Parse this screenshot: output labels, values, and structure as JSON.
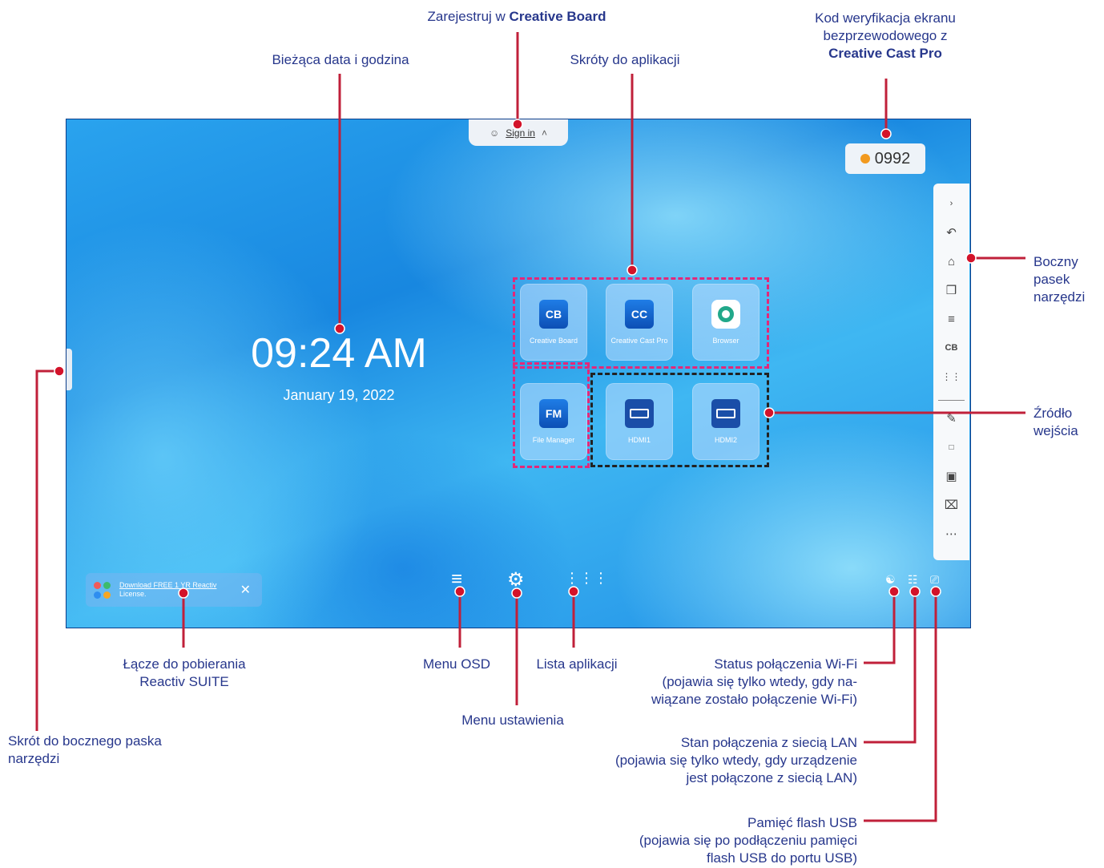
{
  "annotations": {
    "register": {
      "text": "Zarejestruj w ",
      "bold": "Creative Board"
    },
    "datetime": "Bieżąca data i godzina",
    "shortcuts": "Skróty do aplikacji",
    "verify": {
      "line1": "Kod weryfikacja ekranu",
      "line2": "bezprzewodowego z",
      "bold": "Creative Cast Pro"
    },
    "toolbar": {
      "line1": "Boczny",
      "line2": "pasek",
      "line3": "narzędzi"
    },
    "input_source": {
      "line1": "Źródło",
      "line2": "wejścia"
    },
    "sidebar_shortcut": {
      "line1": "Skrót do bocznego paska",
      "line2": "narzędzi"
    },
    "reactiv": {
      "line1": "Łącze do pobierania",
      "line2": "Reactiv SUITE"
    },
    "osd": "Menu OSD",
    "settings": "Menu ustawienia",
    "apps": "Lista aplikacji",
    "wifi": {
      "line1": "Status połączenia Wi-Fi",
      "line2": "(pojawia się tylko wtedy, gdy na-",
      "line3": "wiązane zostało połączenie Wi-Fi)"
    },
    "lan": {
      "line1": "Stan połączenia z siecią LAN",
      "line2": "(pojawia się tylko wtedy, gdy urządzenie",
      "line3": "jest połączone z siecią LAN)"
    },
    "usb": {
      "line1": "Pamięć flash USB",
      "line2": "(pojawia się po podłączeniu pamięci",
      "line3": "flash USB do portu USB)"
    }
  },
  "screen": {
    "signin": "Sign in",
    "code": "0992",
    "time": "09:24 AM",
    "date": "January 19, 2022",
    "apps": [
      {
        "label": "Creative Board",
        "logo": "CB"
      },
      {
        "label": "Creative Cast Pro",
        "logo": "CC"
      },
      {
        "label": "Browser",
        "logo": ""
      },
      {
        "label": "File Manager",
        "logo": "FM"
      },
      {
        "label": "HDMI1",
        "logo": ""
      },
      {
        "label": "HDMI2",
        "logo": ""
      }
    ],
    "banner": {
      "link": "Download FREE 1 YR Reactiv",
      "rest": "License."
    },
    "toolbar_icons": [
      "chevron-right-icon",
      "back-icon",
      "home-icon",
      "windows-icon",
      "menu-icon",
      "creative-board-icon",
      "apps-grid-icon",
      "pen-icon",
      "ratio-icon",
      "screen-record-icon",
      "crop-icon",
      "more-icon"
    ]
  },
  "colors": {
    "annotation_text": "#27378c",
    "leader_line": "#c0203a",
    "marker": "#d3132a",
    "shortcut_frame": "#e3287a",
    "input_frame": "#222222"
  }
}
